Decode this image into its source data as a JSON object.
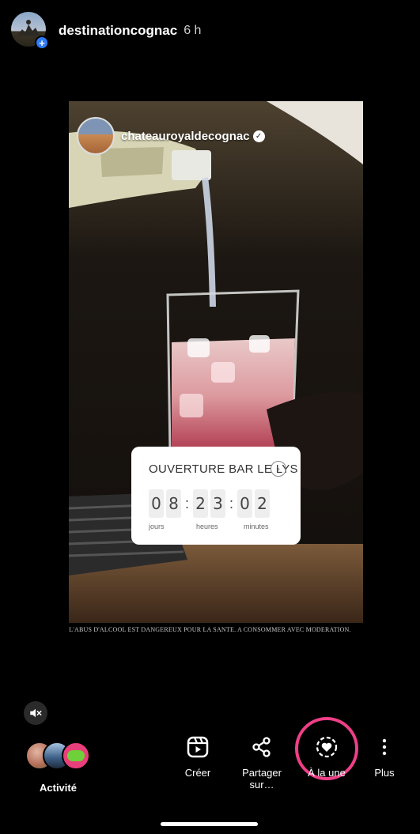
{
  "header": {
    "username": "destinationcognac",
    "time": "6 h",
    "plus_badge": "+"
  },
  "story": {
    "reshared_account": "chateauroyaldecognac",
    "verified_mark": "✓",
    "countdown": {
      "title": "OUVERTURE BAR LE LYS",
      "digits": [
        "0",
        "8",
        "2",
        "3",
        "0",
        "2"
      ],
      "labels": [
        "jours",
        "heures",
        "minutes"
      ]
    },
    "warning": "L'ABUS D'ALCOOL EST DANGEREUX POUR LA SANTE. A CONSOMMER AVEC MODERATION."
  },
  "bottom": {
    "activity_label": "Activité",
    "actions": [
      {
        "label": "Créer",
        "icon": "reels-icon"
      },
      {
        "label": "Partager sur…",
        "icon": "share-icon"
      },
      {
        "label": "À la une",
        "icon": "highlight-heart-icon"
      },
      {
        "label": "Plus",
        "icon": "more-vertical-icon"
      }
    ]
  },
  "colors": {
    "background": "#000000",
    "highlight_ring": "#ee3f87",
    "badge": "#2f7bf5",
    "activity_avatar_green": "#6fd13a",
    "activity_avatar_pink": "#e8407a"
  }
}
